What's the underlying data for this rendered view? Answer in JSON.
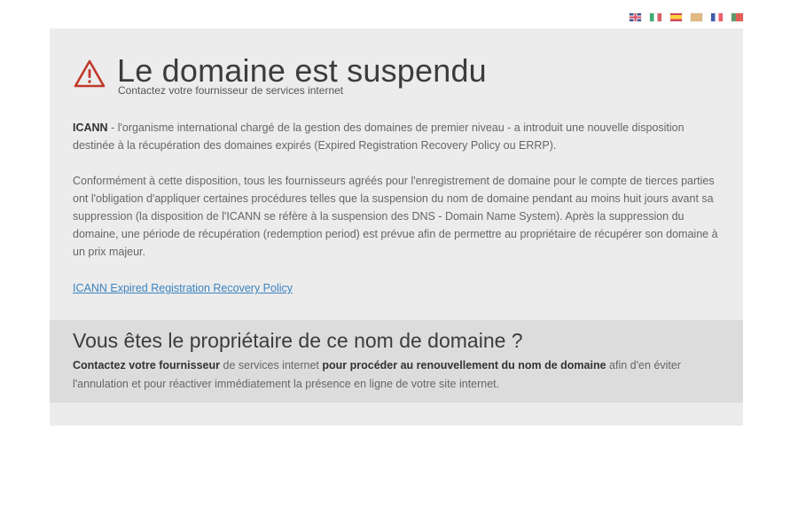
{
  "languages": [
    {
      "code": "en",
      "icon": "uk-flag-icon"
    },
    {
      "code": "it",
      "icon": "italy-flag-icon"
    },
    {
      "code": "es",
      "icon": "spain-flag-icon"
    },
    {
      "code": "de",
      "icon": "germany-flag-icon"
    },
    {
      "code": "fr",
      "icon": "france-flag-icon"
    },
    {
      "code": "pt",
      "icon": "portugal-flag-icon"
    }
  ],
  "header": {
    "title": "Le domaine est suspendu",
    "subtitle": "Contactez votre fournisseur de services internet",
    "icon": "warning-icon",
    "icon_color": "#c0392b"
  },
  "body": {
    "para1_strong": "ICANN",
    "para1_text": " - l'organisme international chargé de la gestion des domaines de premier niveau - a introduit une nouvelle disposition destinée à la récupération des domaines expirés (Expired Registration Recovery Policy ou ERRP).",
    "para2_text": "Conformément à cette disposition, tous les fournisseurs agréés pour l'enregistrement de domaine pour le compte de tierces parties ont l'obligation d'appliquer certaines procédures telles que la suspension du nom de domaine pendant au moins huit jours avant sa suppression (la disposition de l'ICANN se réfère à la suspension des DNS - Domain Name System). Après la suppression du domaine, une période de récupération (redemption period) est prévue afin de permettre au propriétaire de récupérer son domaine à un prix majeur.",
    "link_text": "ICANN Expired Registration Recovery Policy",
    "link_color": "#3a82bf"
  },
  "owner": {
    "title": "Vous êtes le propriétaire de ce nom de domaine ?",
    "strong1": "Contactez votre fournisseur",
    "text1": " de services internet ",
    "strong2": "pour procéder au renouvellement du nom de domaine",
    "text2": " afin d'en éviter l'annulation et pour réactiver immédiatement la présence en ligne de votre site internet."
  }
}
